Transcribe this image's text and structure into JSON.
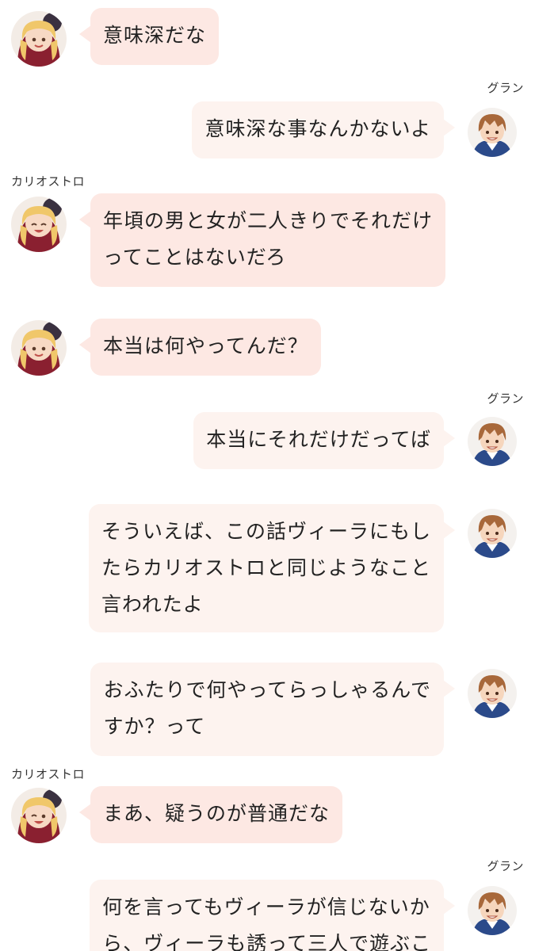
{
  "speakers": {
    "cagliostro": "カリオストロ",
    "gran": "グラン"
  },
  "colors": {
    "left_bubble": "#fde8e3",
    "right_bubble": "#fdf3ef",
    "background": "#ffffff"
  },
  "messages": [
    {
      "side": "left",
      "speaker": "",
      "lines": [
        "意味深だな"
      ]
    },
    {
      "side": "right",
      "speaker": "グラン",
      "lines": [
        "意味深な事なんかないよ"
      ]
    },
    {
      "side": "left",
      "speaker": "カリオストロ",
      "lines": [
        "年頃の男と女が二人きりでそれだけ",
        "ってことはないだろ"
      ]
    },
    {
      "side": "left",
      "speaker": "",
      "lines": [
        "本当は何やってんだ？"
      ]
    },
    {
      "side": "right",
      "speaker": "グラン",
      "lines": [
        "本当にそれだけだってば"
      ]
    },
    {
      "side": "right",
      "speaker": "",
      "lines": [
        "そういえば、この話ヴィーラにもし",
        "たらカリオストロと同じようなこと",
        "言われたよ"
      ]
    },
    {
      "side": "right",
      "speaker": "",
      "lines": [
        "おふたりで何やってらっしゃるんで",
        "すか？って"
      ]
    },
    {
      "side": "left",
      "speaker": "カリオストロ",
      "lines": [
        "まあ、疑うのが普通だな"
      ]
    },
    {
      "side": "right",
      "speaker": "グラン",
      "lines": [
        "何を言ってもヴィーラが信じないか",
        "ら、ヴィーラも誘って三人で遊ぶこ"
      ]
    }
  ]
}
